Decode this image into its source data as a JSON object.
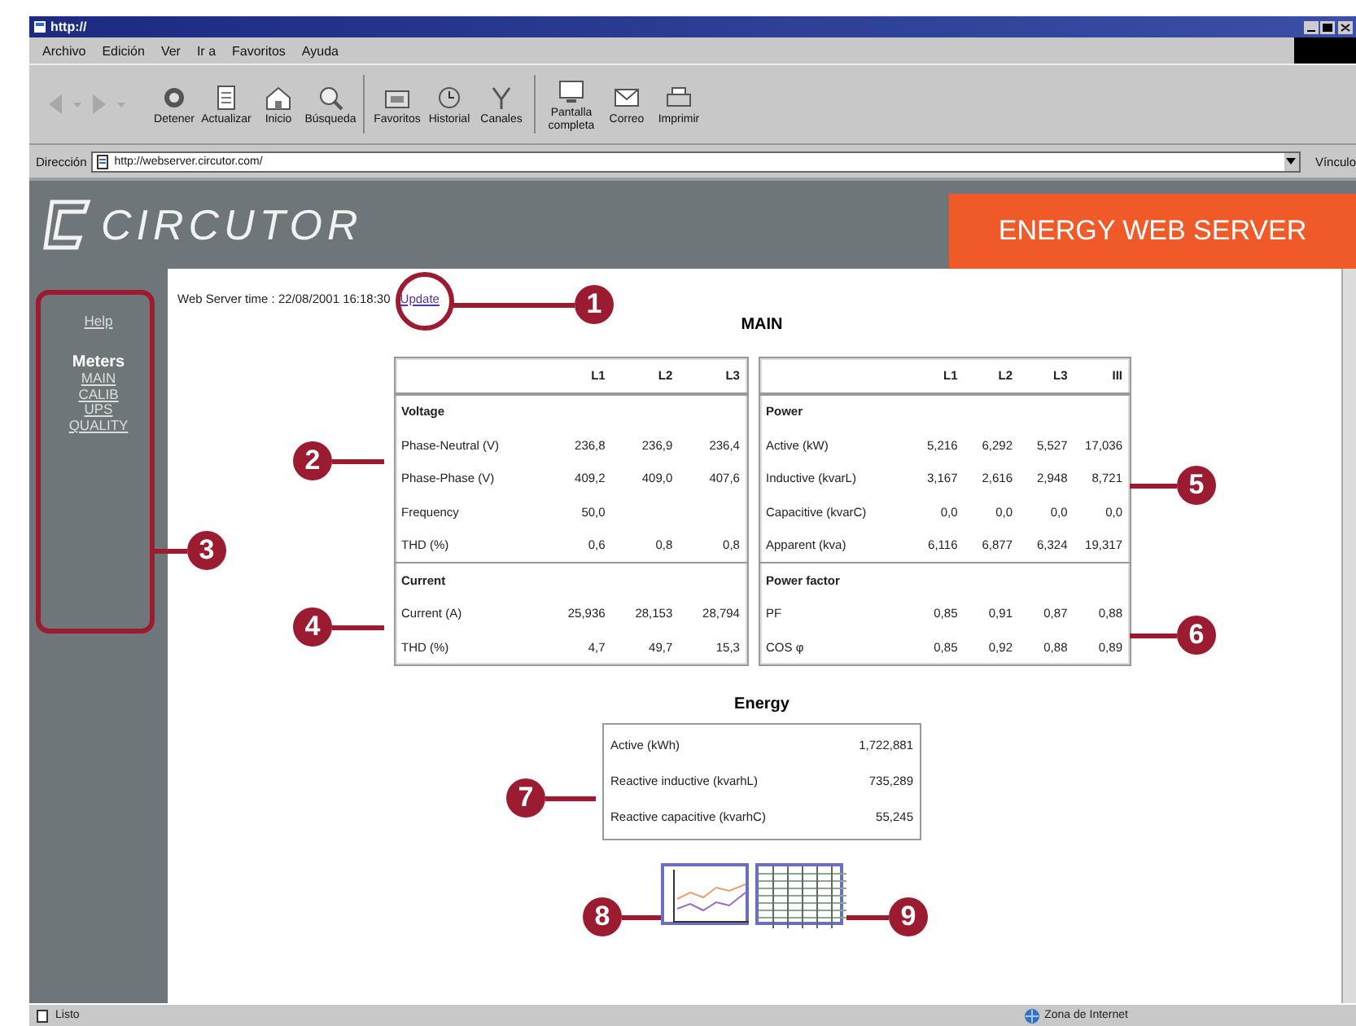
{
  "window": {
    "title": "http://"
  },
  "menu": [
    "Archivo",
    "Edición",
    "Ver",
    "Ir a",
    "Favoritos",
    "Ayuda"
  ],
  "nav_buttons": [
    {
      "kind": "back",
      "disabled": true
    },
    {
      "kind": "forward",
      "disabled": true
    }
  ],
  "toolbar": [
    {
      "label": "Detener"
    },
    {
      "label": "Actualizar"
    },
    {
      "label": "Inicio"
    },
    {
      "label": "Búsqueda"
    },
    {
      "label": "Favoritos"
    },
    {
      "label": "Historial"
    },
    {
      "label": "Canales"
    },
    {
      "label": "Pantalla completa"
    },
    {
      "label": "Correo"
    },
    {
      "label": "Imprimir"
    }
  ],
  "address": {
    "label": "Dirección",
    "value": "http://webserver.circutor.com/",
    "links": "Vínculo"
  },
  "header": {
    "logo": "CIRCUTOR",
    "banner": "ENERGY WEB SERVER"
  },
  "sidebar": {
    "help": "Help",
    "heading": "Meters",
    "links": [
      "MAIN",
      "CALIB",
      "UPS",
      "QUALITY"
    ]
  },
  "content": {
    "time_label": "Web Server time : 22/08/2001 16:18:30",
    "update": "Update",
    "title": "MAIN",
    "tables": [
      {
        "columns": [
          "L1",
          "L2",
          "L3"
        ],
        "sections": [
          {
            "title": "Voltage",
            "rows": [
              {
                "label": "Phase-Neutral (V)",
                "values": [
                  "236,8",
                  "236,9",
                  "236,4"
                ]
              },
              {
                "label": "Phase-Phase (V)",
                "values": [
                  "409,2",
                  "409,0",
                  "407,6"
                ]
              },
              {
                "label": "Frequency",
                "values": [
                  "50,0"
                ]
              },
              {
                "label": "THD (%)",
                "values": [
                  "0,6",
                  "0,8",
                  "0,8"
                ]
              }
            ]
          },
          {
            "title": "Current",
            "rows": [
              {
                "label": "Current (A)",
                "values": [
                  "25,936",
                  "28,153",
                  "28,794"
                ]
              },
              {
                "label": "THD (%)",
                "values": [
                  "4,7",
                  "49,7",
                  "15,3"
                ]
              }
            ]
          }
        ]
      },
      {
        "columns": [
          "L1",
          "L2",
          "L3",
          "III"
        ],
        "sections": [
          {
            "title": "Power",
            "rows": [
              {
                "label": "Active (kW)",
                "values": [
                  "5,216",
                  "6,292",
                  "5,527",
                  "17,036"
                ]
              },
              {
                "label": "Inductive (kvarL)",
                "values": [
                  "3,167",
                  "2,616",
                  "2,948",
                  "8,721"
                ]
              },
              {
                "label": "Capacitive (kvarC)",
                "values": [
                  "0,0",
                  "0,0",
                  "0,0",
                  "0,0"
                ]
              },
              {
                "label": "Apparent (kva)",
                "values": [
                  "6,116",
                  "6,877",
                  "6,324",
                  "19,317"
                ]
              }
            ]
          },
          {
            "title": "Power factor",
            "rows": [
              {
                "label": "PF",
                "values": [
                  "0,85",
                  "0,91",
                  "0,87",
                  "0,88"
                ]
              },
              {
                "label": "COS φ",
                "values": [
                  "0,85",
                  "0,92",
                  "0,88",
                  "0,89"
                ]
              }
            ]
          }
        ]
      }
    ],
    "energy": {
      "title": "Energy",
      "rows": [
        {
          "label": "Active (kWh)",
          "value": "1,722,881"
        },
        {
          "label": "Reactive inductive (kvarhL)",
          "value": "735,289"
        },
        {
          "label": "Reactive capacitive (kvarhC)",
          "value": "55,245"
        }
      ]
    },
    "thumbnails": [
      {
        "kind": "chart"
      },
      {
        "kind": "table"
      }
    ]
  },
  "status_bar": {
    "text": "Listo",
    "zone": "Zona de Internet"
  },
  "callouts": [
    "1",
    "2",
    "3",
    "4",
    "5",
    "6",
    "7",
    "8",
    "9"
  ]
}
